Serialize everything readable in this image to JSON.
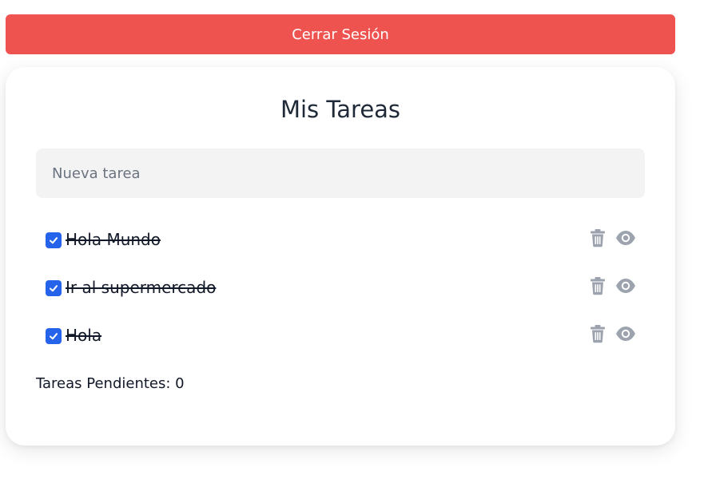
{
  "logout": {
    "label": "Cerrar Sesión"
  },
  "card": {
    "title": "Mis Tareas",
    "new_task_placeholder": "Nueva tarea",
    "tasks": [
      {
        "text": "Hola Mundo",
        "completed": true
      },
      {
        "text": "Ir al supermercado",
        "completed": true
      },
      {
        "text": "Hola",
        "completed": true
      }
    ],
    "pending_label": "Tareas Pendientes:",
    "pending_count": "0"
  },
  "colors": {
    "logout_bg": "#ef5350",
    "checkbox": "#2563eb",
    "icon_gray": "#9ca3af",
    "input_bg": "#f3f3f3"
  },
  "icons": [
    "check-icon",
    "trash-icon",
    "eye-icon"
  ]
}
